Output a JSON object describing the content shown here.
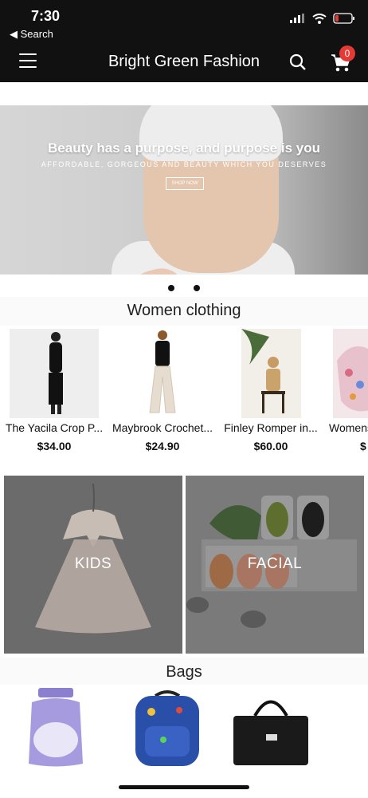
{
  "status_bar": {
    "time": "7:30",
    "back_label": "◀ Search"
  },
  "header": {
    "title": "Bright Green Fashion",
    "cart_count": "0"
  },
  "hero": {
    "headline": "Beauty has a purpose, and purpose is you",
    "subtext": "AFFORDABLE, GORGEOUS AND BEAUTY WHICH YOU DESERVES",
    "button_label": "SHOP NOW"
  },
  "sections": {
    "women": {
      "title": "Women clothing",
      "products": [
        {
          "name": "The Yacila Crop P...",
          "price": "$34.00"
        },
        {
          "name": "Maybrook Crochet...",
          "price": "$24.90"
        },
        {
          "name": "Finley Romper in...",
          "price": "$60.00"
        },
        {
          "name": "Womens",
          "price": "$"
        }
      ]
    },
    "categories": [
      {
        "label": "KIDS"
      },
      {
        "label": "FACIAL"
      }
    ],
    "bags": {
      "title": "Bags"
    }
  },
  "colors": {
    "bar": "#111111",
    "badge": "#e53935",
    "tile_overlay": "#5a5a5a"
  }
}
